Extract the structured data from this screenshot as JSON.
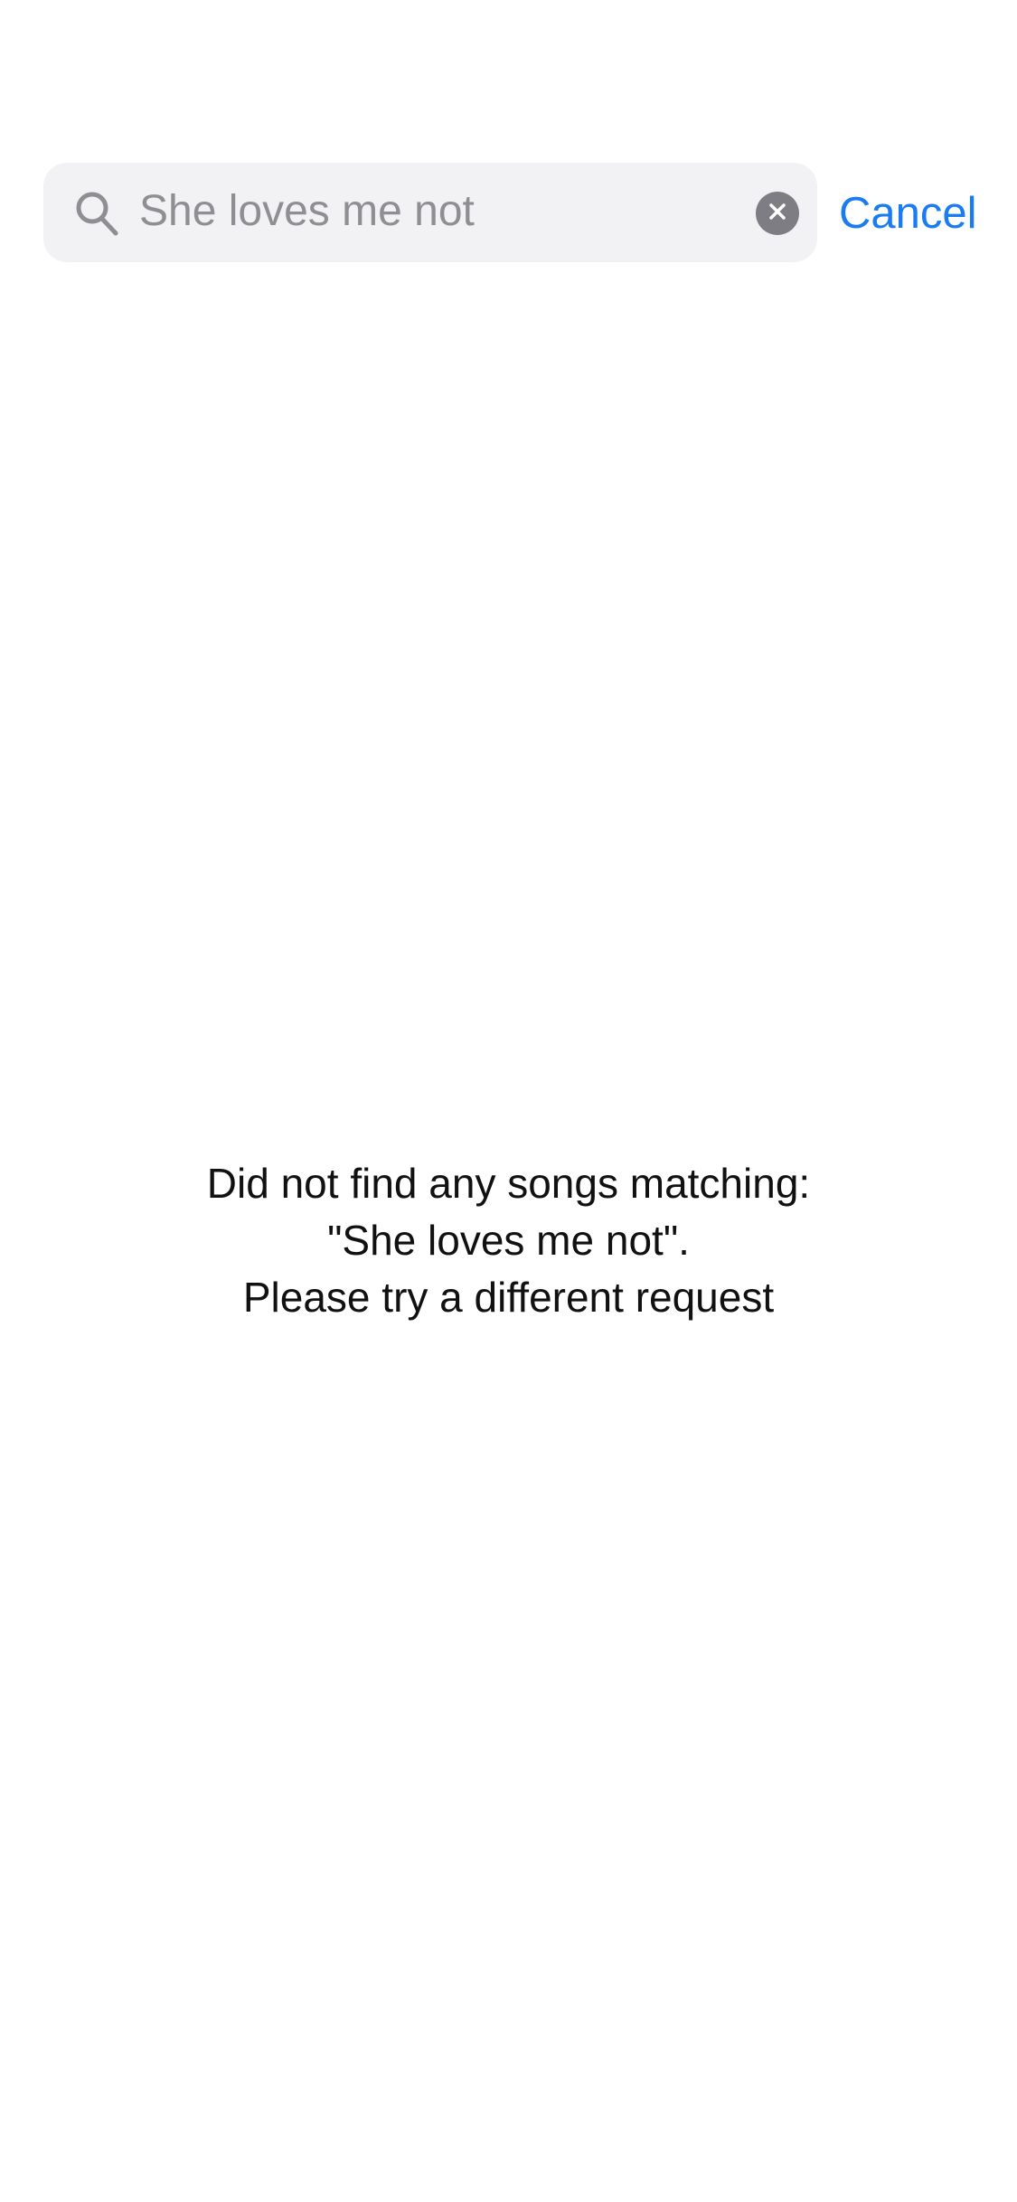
{
  "search": {
    "query": "She loves me not",
    "cancel_label": "Cancel",
    "search_icon": "search-icon",
    "clear_icon": "clear-icon"
  },
  "empty_state": {
    "line1": "Did not find any songs matching:",
    "line2": "\"She loves me not\".",
    "line3": "Please try a different request"
  },
  "colors": {
    "accent": "#1a7cf0",
    "search_field_bg": "#f2f2f5",
    "placeholder_text": "#8e8e93",
    "clear_button": "#7d7d83",
    "body_text": "#111111"
  }
}
